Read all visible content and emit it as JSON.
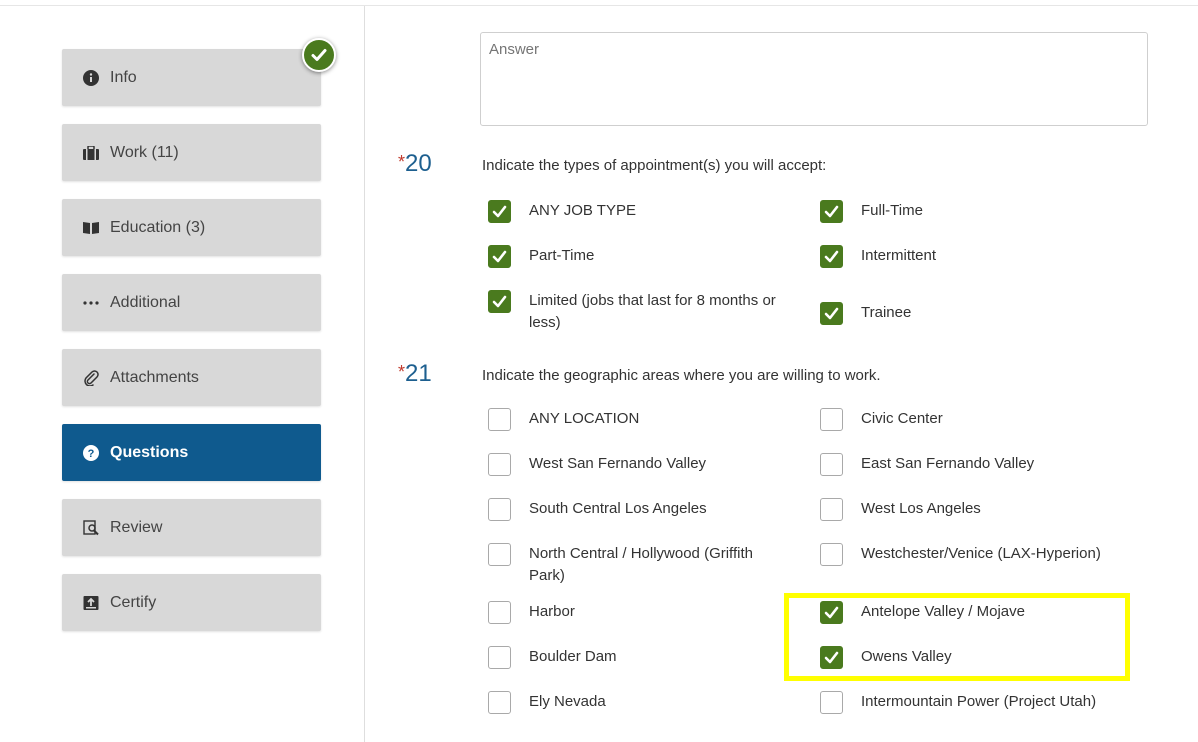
{
  "sidebar": {
    "items": [
      {
        "label": "Info",
        "icon": "info-icon",
        "active": false,
        "completed": true
      },
      {
        "label": "Work (11)",
        "icon": "briefcase-icon",
        "active": false
      },
      {
        "label": "Education (3)",
        "icon": "book-icon",
        "active": false
      },
      {
        "label": "Additional",
        "icon": "ellipsis-icon",
        "active": false
      },
      {
        "label": "Attachments",
        "icon": "paperclip-icon",
        "active": false
      },
      {
        "label": "Questions",
        "icon": "question-circle-icon",
        "active": true
      },
      {
        "label": "Review",
        "icon": "review-icon",
        "active": false
      },
      {
        "label": "Certify",
        "icon": "certify-icon",
        "active": false
      }
    ]
  },
  "answer": {
    "placeholder": "Answer",
    "value": ""
  },
  "questions": [
    {
      "number": "20",
      "required_marker": "*",
      "text": "Indicate the types of appointment(s) you will accept:",
      "options": [
        {
          "label": "ANY JOB TYPE",
          "checked": true
        },
        {
          "label": "Full-Time",
          "checked": true
        },
        {
          "label": "Part-Time",
          "checked": true
        },
        {
          "label": "Intermittent",
          "checked": true
        },
        {
          "label": "Limited (jobs that last for 8 months or less)",
          "checked": true
        },
        {
          "label": "Trainee",
          "checked": true
        }
      ]
    },
    {
      "number": "21",
      "required_marker": "*",
      "text": "Indicate the geographic areas where you are willing to work.",
      "options": [
        {
          "label": "ANY LOCATION",
          "checked": false
        },
        {
          "label": "Civic Center",
          "checked": false
        },
        {
          "label": "West San Fernando Valley",
          "checked": false
        },
        {
          "label": "East San Fernando Valley",
          "checked": false
        },
        {
          "label": "South Central Los Angeles",
          "checked": false
        },
        {
          "label": "West Los Angeles",
          "checked": false
        },
        {
          "label": "North Central / Hollywood (Griffith Park)",
          "checked": false
        },
        {
          "label": "Westchester/Venice (LAX-Hyperion)",
          "checked": false
        },
        {
          "label": "Harbor",
          "checked": false
        },
        {
          "label": "Antelope Valley / Mojave",
          "checked": true
        },
        {
          "label": "Boulder Dam",
          "checked": false
        },
        {
          "label": "Owens Valley",
          "checked": true
        },
        {
          "label": "Ely Nevada",
          "checked": false
        },
        {
          "label": "Intermountain Power (Project Utah)",
          "checked": false
        }
      ]
    }
  ],
  "colors": {
    "active_nav": "#0f5a8e",
    "checkbox_checked": "#4a7a1e",
    "question_number": "#1d5f8f",
    "required_marker": "#c0392b",
    "highlight": "#ffff00"
  }
}
